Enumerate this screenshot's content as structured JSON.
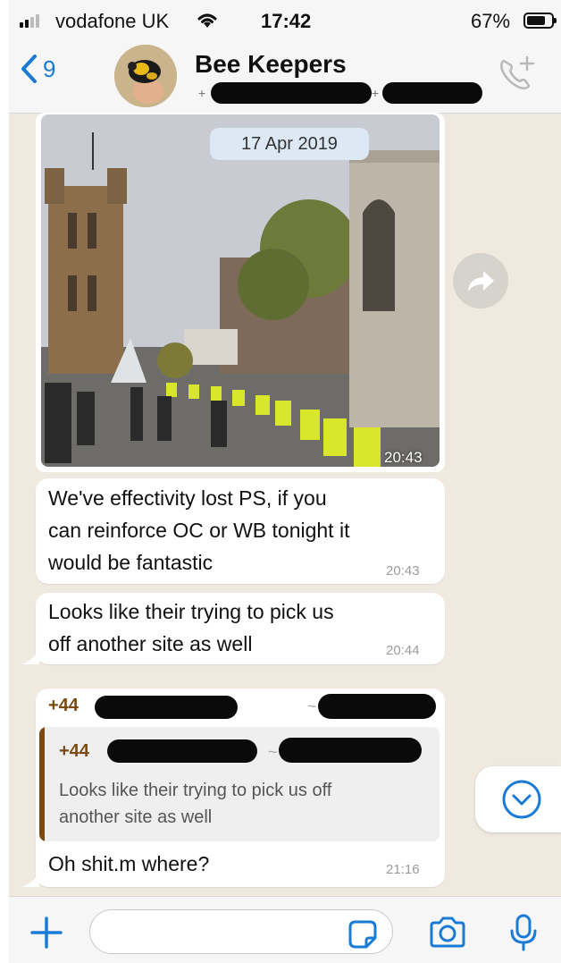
{
  "status_bar": {
    "carrier": "vodafone UK",
    "time": "17:42",
    "battery_percent": "67%"
  },
  "header": {
    "back_count": "9",
    "chat_title": "Bee Keepers"
  },
  "messages": [
    {
      "type": "date",
      "text": "17 Apr 2019"
    },
    {
      "type": "image",
      "time": "20:43"
    },
    {
      "type": "text",
      "lines": [
        "We've effectivity lost PS, if you",
        "can reinforce OC or WB tonight it",
        "would be fantastic"
      ],
      "time": "20:43"
    },
    {
      "type": "text",
      "lines": [
        "Looks like their trying to pick us",
        "off another site as well"
      ],
      "time": "20:44"
    },
    {
      "type": "reply",
      "sender_prefix": "+44",
      "quoted": {
        "sender_prefix": "+44",
        "lines": [
          "Looks like their trying to pick us off",
          "another site as well"
        ]
      },
      "text": "Oh shit.m where?",
      "time": "21:16"
    }
  ],
  "colors": {
    "accent": "#1a7bd6",
    "chat_background": "#efe9e0",
    "date_chip": "#dce8f4",
    "sender_name": "#7a4a12"
  },
  "icons": [
    "back-chevron-icon",
    "add-call-icon",
    "forward-icon",
    "scroll-down-icon",
    "plus-icon",
    "sticker-icon",
    "camera-icon",
    "microphone-icon"
  ]
}
